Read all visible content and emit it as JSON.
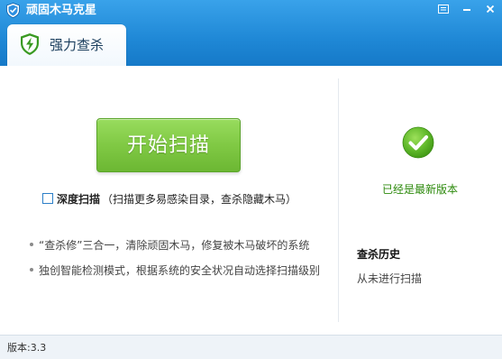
{
  "window": {
    "title": "顽固木马克星",
    "controls": {
      "menu_icon": "menu-icon",
      "minimize_icon": "minimize-icon",
      "close_icon": "close-icon"
    }
  },
  "tabs": [
    {
      "label": "强力查杀",
      "icon": "shield-lightning-icon",
      "active": true
    }
  ],
  "main": {
    "scan_button_label": "开始扫描",
    "deep_scan": {
      "checked": false,
      "label": "深度扫描",
      "description": "（扫描更多易感染目录，查杀隐藏木马）"
    },
    "features": [
      "“查杀修”三合一，清除顽固木马，修复被木马破坏的系统",
      "独创智能检测模式，根据系统的安全状况自动选择扫描级别"
    ]
  },
  "side": {
    "status_icon": "check-circle-icon",
    "status_text": "已经是最新版本",
    "history_title": "查杀历史",
    "history_value": "从未进行扫描"
  },
  "footer": {
    "version": "版本:3.3"
  },
  "colors": {
    "header_blue": "#1f88d6",
    "scan_button_green": "#80c944",
    "status_green": "#2d8a0c",
    "footer_bg": "#eef3f8"
  }
}
